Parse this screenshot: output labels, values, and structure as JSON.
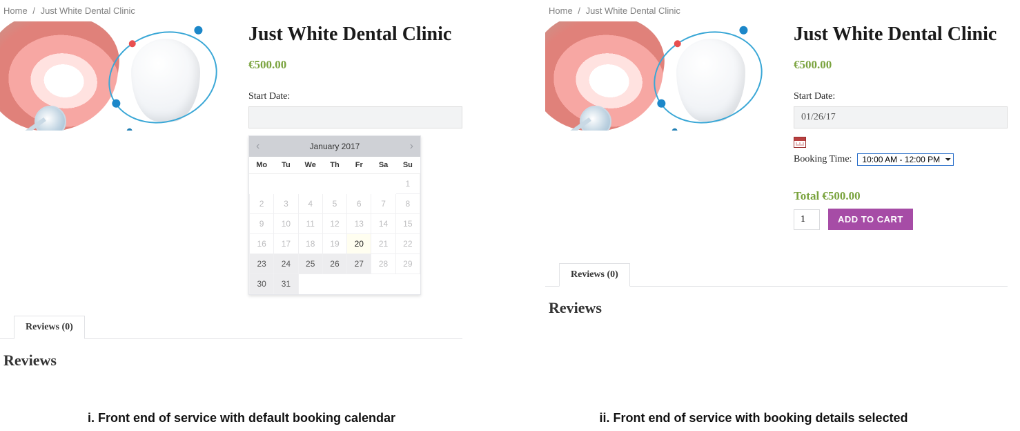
{
  "breadcrumb": {
    "home": "Home",
    "sep": "/",
    "current": "Just White Dental Clinic"
  },
  "product": {
    "title": "Just White Dental Clinic",
    "price": "€500.00",
    "start_date_label": "Start Date:"
  },
  "calendar": {
    "month_title": "January 2017",
    "headers": [
      "Mo",
      "Tu",
      "We",
      "Th",
      "Fr",
      "Sa",
      "Su"
    ],
    "weeks": [
      [
        {
          "d": "",
          "c": "empty"
        },
        {
          "d": "",
          "c": "empty"
        },
        {
          "d": "",
          "c": "empty"
        },
        {
          "d": "",
          "c": "empty"
        },
        {
          "d": "",
          "c": "empty"
        },
        {
          "d": "",
          "c": "empty"
        },
        {
          "d": "1",
          "c": ""
        }
      ],
      [
        {
          "d": "2",
          "c": ""
        },
        {
          "d": "3",
          "c": ""
        },
        {
          "d": "4",
          "c": ""
        },
        {
          "d": "5",
          "c": ""
        },
        {
          "d": "6",
          "c": ""
        },
        {
          "d": "7",
          "c": ""
        },
        {
          "d": "8",
          "c": ""
        }
      ],
      [
        {
          "d": "9",
          "c": ""
        },
        {
          "d": "10",
          "c": ""
        },
        {
          "d": "11",
          "c": ""
        },
        {
          "d": "12",
          "c": ""
        },
        {
          "d": "13",
          "c": ""
        },
        {
          "d": "14",
          "c": ""
        },
        {
          "d": "15",
          "c": ""
        }
      ],
      [
        {
          "d": "16",
          "c": ""
        },
        {
          "d": "17",
          "c": ""
        },
        {
          "d": "18",
          "c": ""
        },
        {
          "d": "19",
          "c": ""
        },
        {
          "d": "20",
          "c": "today"
        },
        {
          "d": "21",
          "c": ""
        },
        {
          "d": "22",
          "c": ""
        }
      ],
      [
        {
          "d": "23",
          "c": "avail"
        },
        {
          "d": "24",
          "c": "avail"
        },
        {
          "d": "25",
          "c": "avail"
        },
        {
          "d": "26",
          "c": "avail"
        },
        {
          "d": "27",
          "c": "avail"
        },
        {
          "d": "28",
          "c": ""
        },
        {
          "d": "29",
          "c": ""
        }
      ],
      [
        {
          "d": "30",
          "c": "avail"
        },
        {
          "d": "31",
          "c": "avail"
        },
        {
          "d": "",
          "c": "empty"
        },
        {
          "d": "",
          "c": "empty"
        },
        {
          "d": "",
          "c": "empty"
        },
        {
          "d": "",
          "c": "empty"
        },
        {
          "d": "",
          "c": "empty"
        }
      ]
    ]
  },
  "reviews": {
    "tab_label": "Reviews (0)",
    "heading": "Reviews"
  },
  "booking": {
    "start_date_value": "01/26/17",
    "booking_time_label": "Booking Time:",
    "booking_time_value": "10:00 AM - 12:00 PM",
    "total_label": "Total ",
    "total_value": "€500.00",
    "qty": "1",
    "add_to_cart": "ADD TO CART"
  },
  "captions": {
    "left": "i. Front end of service with default booking calendar",
    "right": "ii. Front end of service with booking details selected"
  }
}
